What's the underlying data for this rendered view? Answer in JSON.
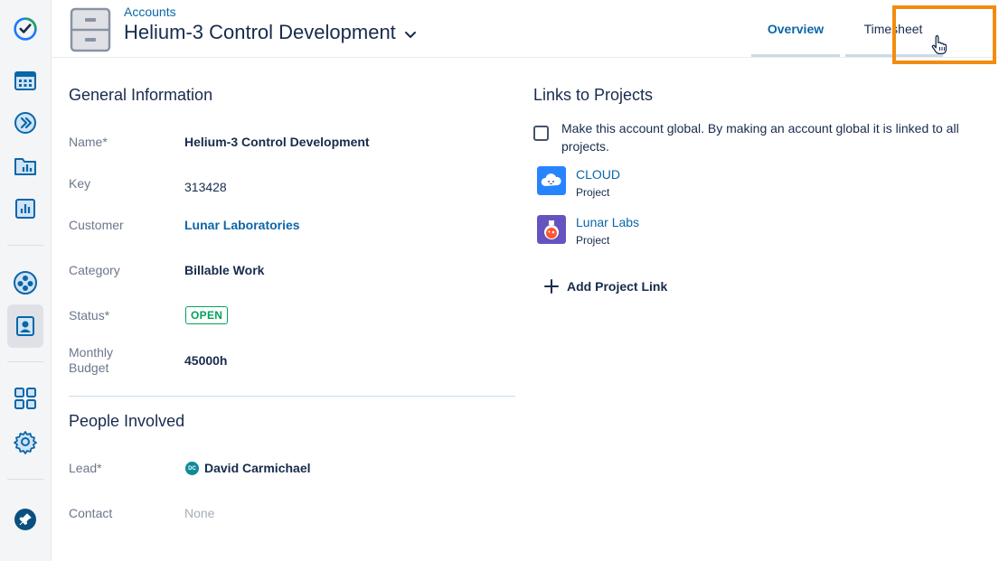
{
  "header": {
    "breadcrumb": "Accounts",
    "title": "Helium-3 Control Development",
    "tabs": [
      {
        "label": "Overview",
        "active": true
      },
      {
        "label": "Timesheet",
        "active": false
      }
    ]
  },
  "sidebar": {
    "icons": [
      "tempo-logo-icon",
      "calendar-icon",
      "forward-icon",
      "folder-chart-icon",
      "bar-chart-icon",
      "team-icon",
      "account-icon",
      "apps-icon",
      "gear-icon",
      "pin-icon"
    ],
    "active": "account-icon"
  },
  "general": {
    "title": "General Information",
    "fields": [
      {
        "label": "Name*",
        "value": "Helium-3 Control Development"
      },
      {
        "label": "Key",
        "value": "313428"
      },
      {
        "label": "Customer",
        "value": "Lunar Laboratories"
      },
      {
        "label": "Category",
        "value": "Billable Work"
      },
      {
        "label": "Status*",
        "value": "OPEN"
      },
      {
        "label": "Monthly Budget",
        "value": "45000h"
      }
    ]
  },
  "people": {
    "title": "People Involved",
    "lead_label": "Lead*",
    "lead_initials": "DC",
    "lead_name": "David Carmichael",
    "contact_label": "Contact",
    "contact_value": "None"
  },
  "links": {
    "title": "Links to Projects",
    "global_text": "Make this account global. By making an account global it is linked to all projects.",
    "global_checked": false,
    "projects": [
      {
        "name": "CLOUD",
        "type": "Project"
      },
      {
        "name": "Lunar Labs",
        "type": "Project"
      }
    ],
    "add_label": "Add Project Link"
  },
  "colors": {
    "accent": "#0b66a8",
    "status_green": "#00a35a",
    "highlight": "#f28c0f"
  }
}
